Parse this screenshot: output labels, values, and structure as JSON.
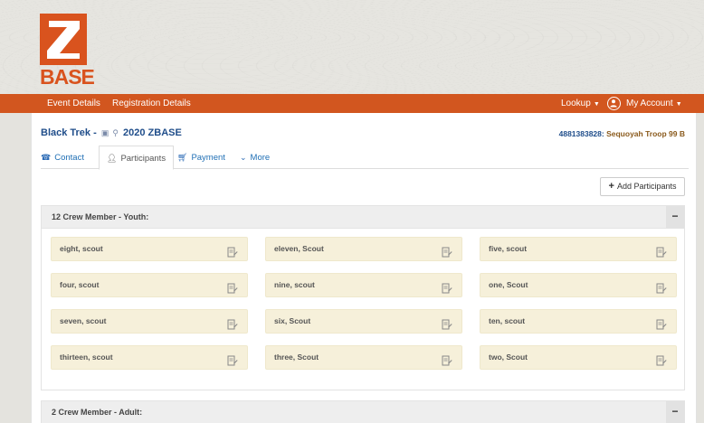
{
  "logo": {
    "letter": "Z",
    "word": "BASE"
  },
  "nav": {
    "left": [
      "Event Details",
      "Registration Details"
    ],
    "lookup": "Lookup",
    "account": "My Account"
  },
  "event": {
    "name": "Black Trek -",
    "title": "2020 ZBASE",
    "account_id": "4881383828:",
    "troop": "Sequoyah Troop 99 B"
  },
  "tabs": [
    "Contact",
    "Participants",
    "Payment",
    "More"
  ],
  "add_button": "Add Participants",
  "sections": [
    {
      "title": "12 Crew Member - Youth:",
      "collapse": "−",
      "members": [
        "eight, scout",
        "eleven, Scout",
        "five, scout",
        "four, scout",
        "nine, scout",
        "one, Scout",
        "seven, scout",
        "six, Scout",
        "ten, scout",
        "thirteen, scout",
        "three, Scout",
        "two, Scout"
      ]
    },
    {
      "title": "2 Crew Member - Adult:",
      "collapse": "−",
      "members": []
    }
  ],
  "colors": {
    "accent": "#d2561f",
    "link": "#1f6fb5",
    "member_bg": "#f6f0da"
  }
}
